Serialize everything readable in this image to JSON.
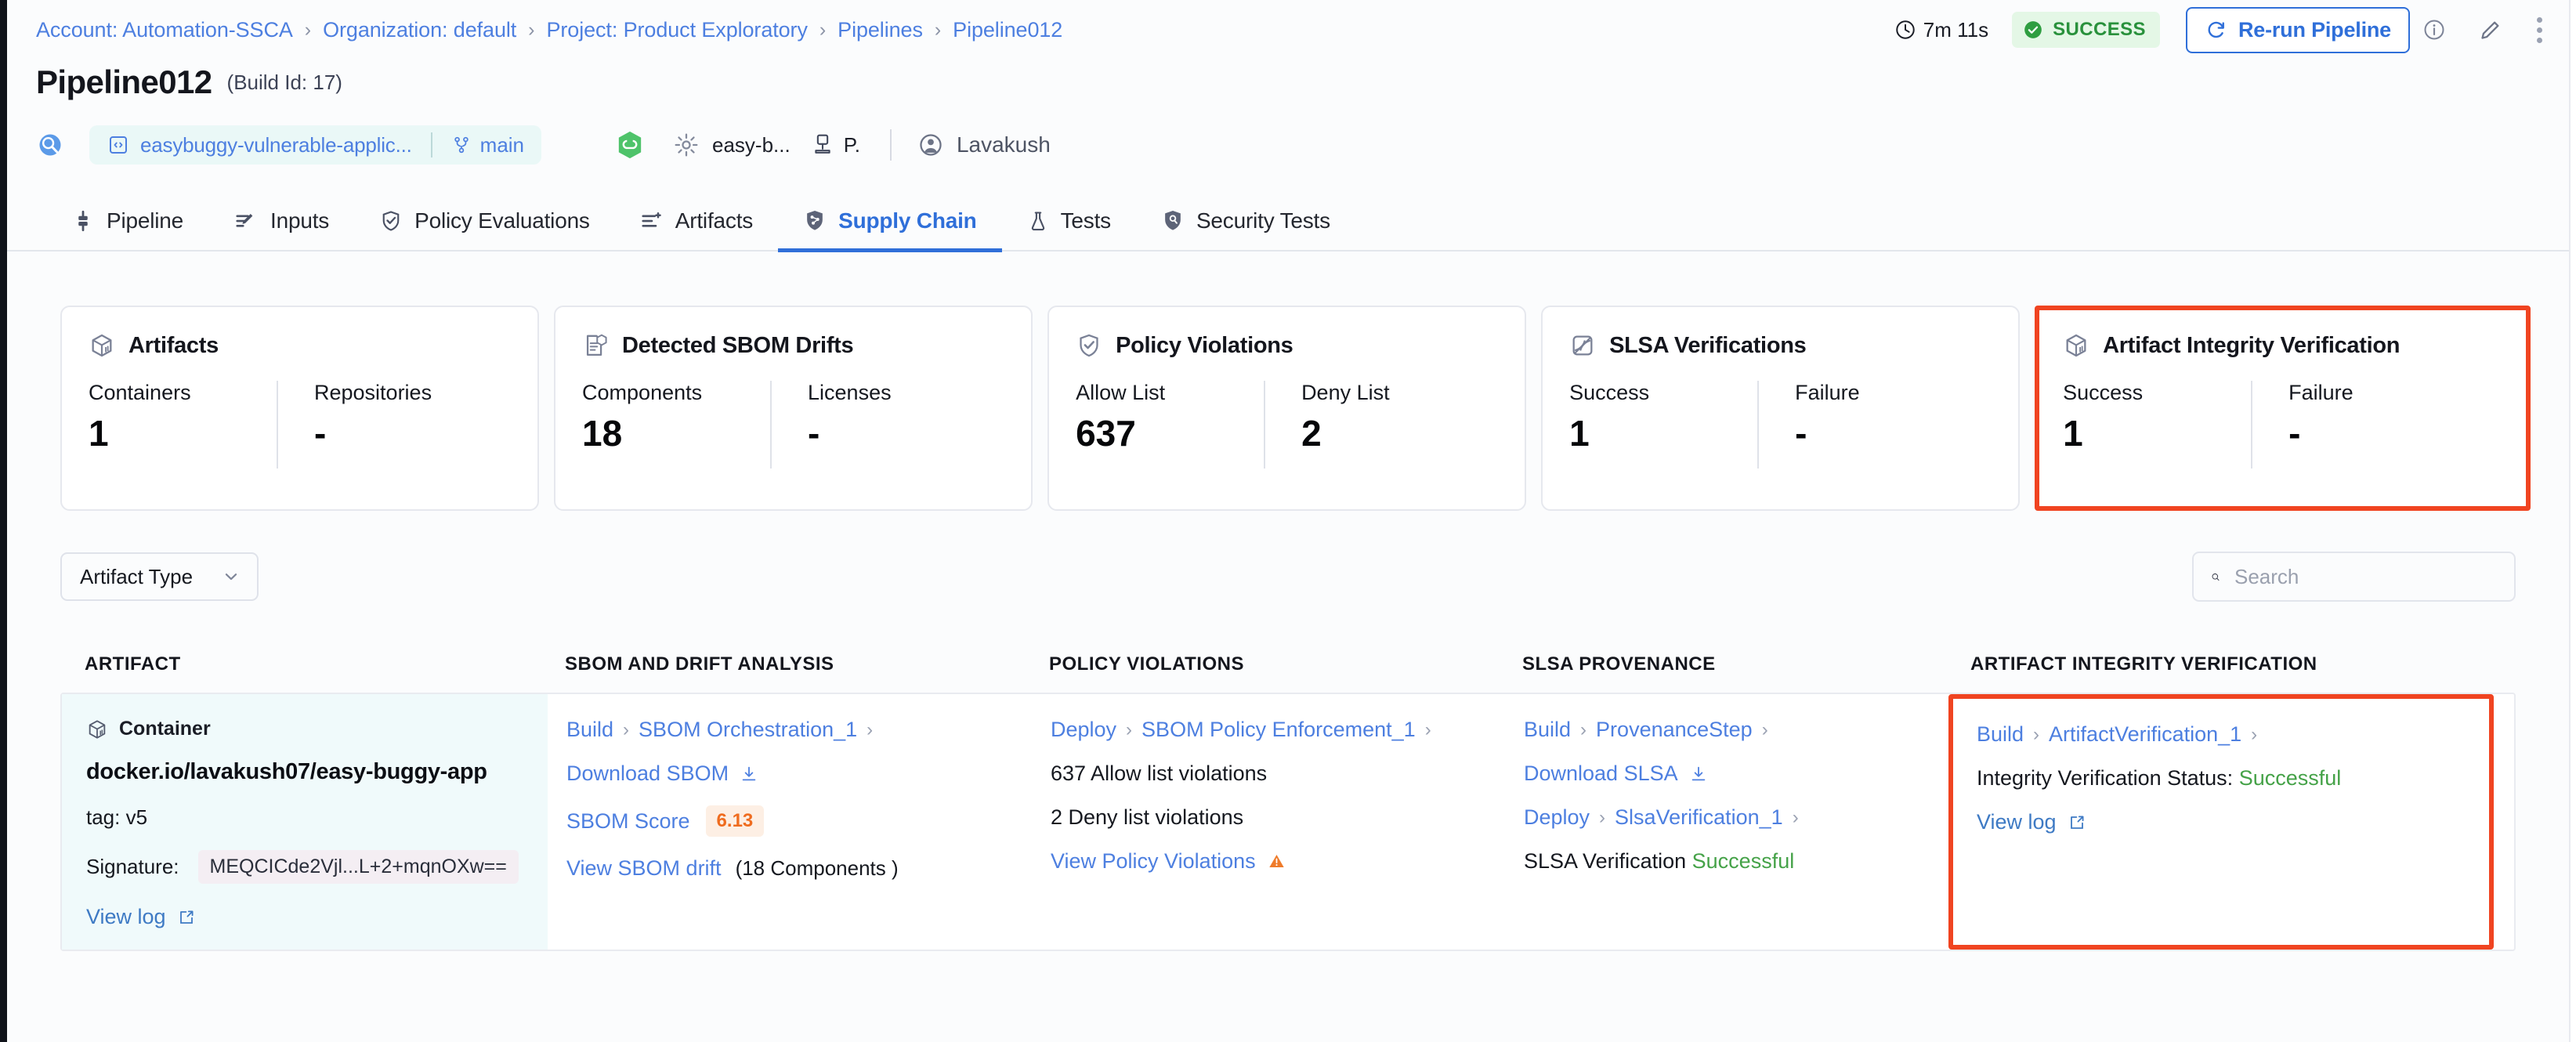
{
  "breadcrumb": [
    {
      "label": "Account: Automation-SSCA"
    },
    {
      "label": "Organization: default"
    },
    {
      "label": "Project: Product Exploratory"
    },
    {
      "label": "Pipelines"
    },
    {
      "label": "Pipeline012"
    }
  ],
  "header": {
    "duration": "7m 11s",
    "status": "SUCCESS",
    "rerun_label": "Re-run Pipeline",
    "title": "Pipeline012",
    "build_id": "(Build Id: 17)",
    "repo": "easybuggy-vulnerable-applic...",
    "branch": "main",
    "service": "easy-b...",
    "environment": "P.",
    "user": "Lavakush"
  },
  "tabs": [
    {
      "label": "Pipeline",
      "icon": "pipeline-icon",
      "active": false
    },
    {
      "label": "Inputs",
      "icon": "inputs-icon",
      "active": false
    },
    {
      "label": "Policy Evaluations",
      "icon": "policy-shield-icon",
      "active": false
    },
    {
      "label": "Artifacts",
      "icon": "artifacts-list-icon",
      "active": false
    },
    {
      "label": "Supply Chain",
      "icon": "supply-chain-shield-icon",
      "active": true
    },
    {
      "label": "Tests",
      "icon": "flask-icon",
      "active": false
    },
    {
      "label": "Security Tests",
      "icon": "security-shield-icon",
      "active": false
    }
  ],
  "cards": [
    {
      "title": "Artifacts",
      "icon": "cube-icon",
      "highlighted": false,
      "metrics": [
        {
          "label": "Containers",
          "value": "1"
        },
        {
          "label": "Repositories",
          "value": "-"
        }
      ]
    },
    {
      "title": "Detected SBOM Drifts",
      "icon": "sbom-doc-icon",
      "highlighted": false,
      "metrics": [
        {
          "label": "Components",
          "value": "18"
        },
        {
          "label": "Licenses",
          "value": "-"
        }
      ]
    },
    {
      "title": "Policy Violations",
      "icon": "check-shield-icon",
      "highlighted": false,
      "metrics": [
        {
          "label": "Allow List",
          "value": "637"
        },
        {
          "label": "Deny List",
          "value": "2"
        }
      ]
    },
    {
      "title": "SLSA Verifications",
      "icon": "slsa-icon",
      "highlighted": false,
      "metrics": [
        {
          "label": "Success",
          "value": "1"
        },
        {
          "label": "Failure",
          "value": "-"
        }
      ]
    },
    {
      "title": "Artifact Integrity Verification",
      "icon": "cube-icon",
      "highlighted": true,
      "metrics": [
        {
          "label": "Success",
          "value": "1"
        },
        {
          "label": "Failure",
          "value": "-"
        }
      ]
    }
  ],
  "filters": {
    "artifact_type_label": "Artifact Type",
    "search_placeholder": "Search",
    "search_value": ""
  },
  "table": {
    "columns": [
      {
        "header": "ARTIFACT"
      },
      {
        "header": "SBOM AND DRIFT ANALYSIS"
      },
      {
        "header": "POLICY VIOLATIONS"
      },
      {
        "header": "SLSA PROVENANCE"
      },
      {
        "header": "ARTIFACT INTEGRITY VERIFICATION"
      }
    ],
    "row": {
      "artifact": {
        "kind": "Container",
        "name": "docker.io/lavakush07/easy-buggy-app",
        "tag": "tag: v5",
        "signature_label": "Signature:",
        "signature_value": "MEQCICde2Vjl...L+2+mqnOXw==",
        "view_log": "View log"
      },
      "sbom": {
        "crumbs": [
          "Build",
          "SBOM Orchestration_1"
        ],
        "download_label": "Download SBOM",
        "score_label": "SBOM Score",
        "score_value": "6.13",
        "drift_link": "View SBOM drift",
        "drift_count": "(18 Components )"
      },
      "policy": {
        "crumbs": [
          "Deploy",
          "SBOM Policy Enforcement_1"
        ],
        "allow_text": "637 Allow list violations",
        "deny_text": "2 Deny list violations",
        "view_link": "View Policy Violations"
      },
      "slsa": {
        "crumbs1": [
          "Build",
          "ProvenanceStep"
        ],
        "download_label": "Download SLSA",
        "crumbs2": [
          "Deploy",
          "SlsaVerification_1"
        ],
        "verify_label": "SLSA Verification",
        "verify_status": "Successful"
      },
      "integrity": {
        "crumbs": [
          "Build",
          "ArtifactVerification_1"
        ],
        "status_label": "Integrity Verification Status:",
        "status_value": "Successful",
        "view_log": "View log"
      }
    }
  },
  "colors": {
    "link": "#4d7fe0",
    "accent": "#2f6fd9",
    "success": "#29913c",
    "highlight": "#f04421",
    "warn": "#ef6c1f"
  }
}
